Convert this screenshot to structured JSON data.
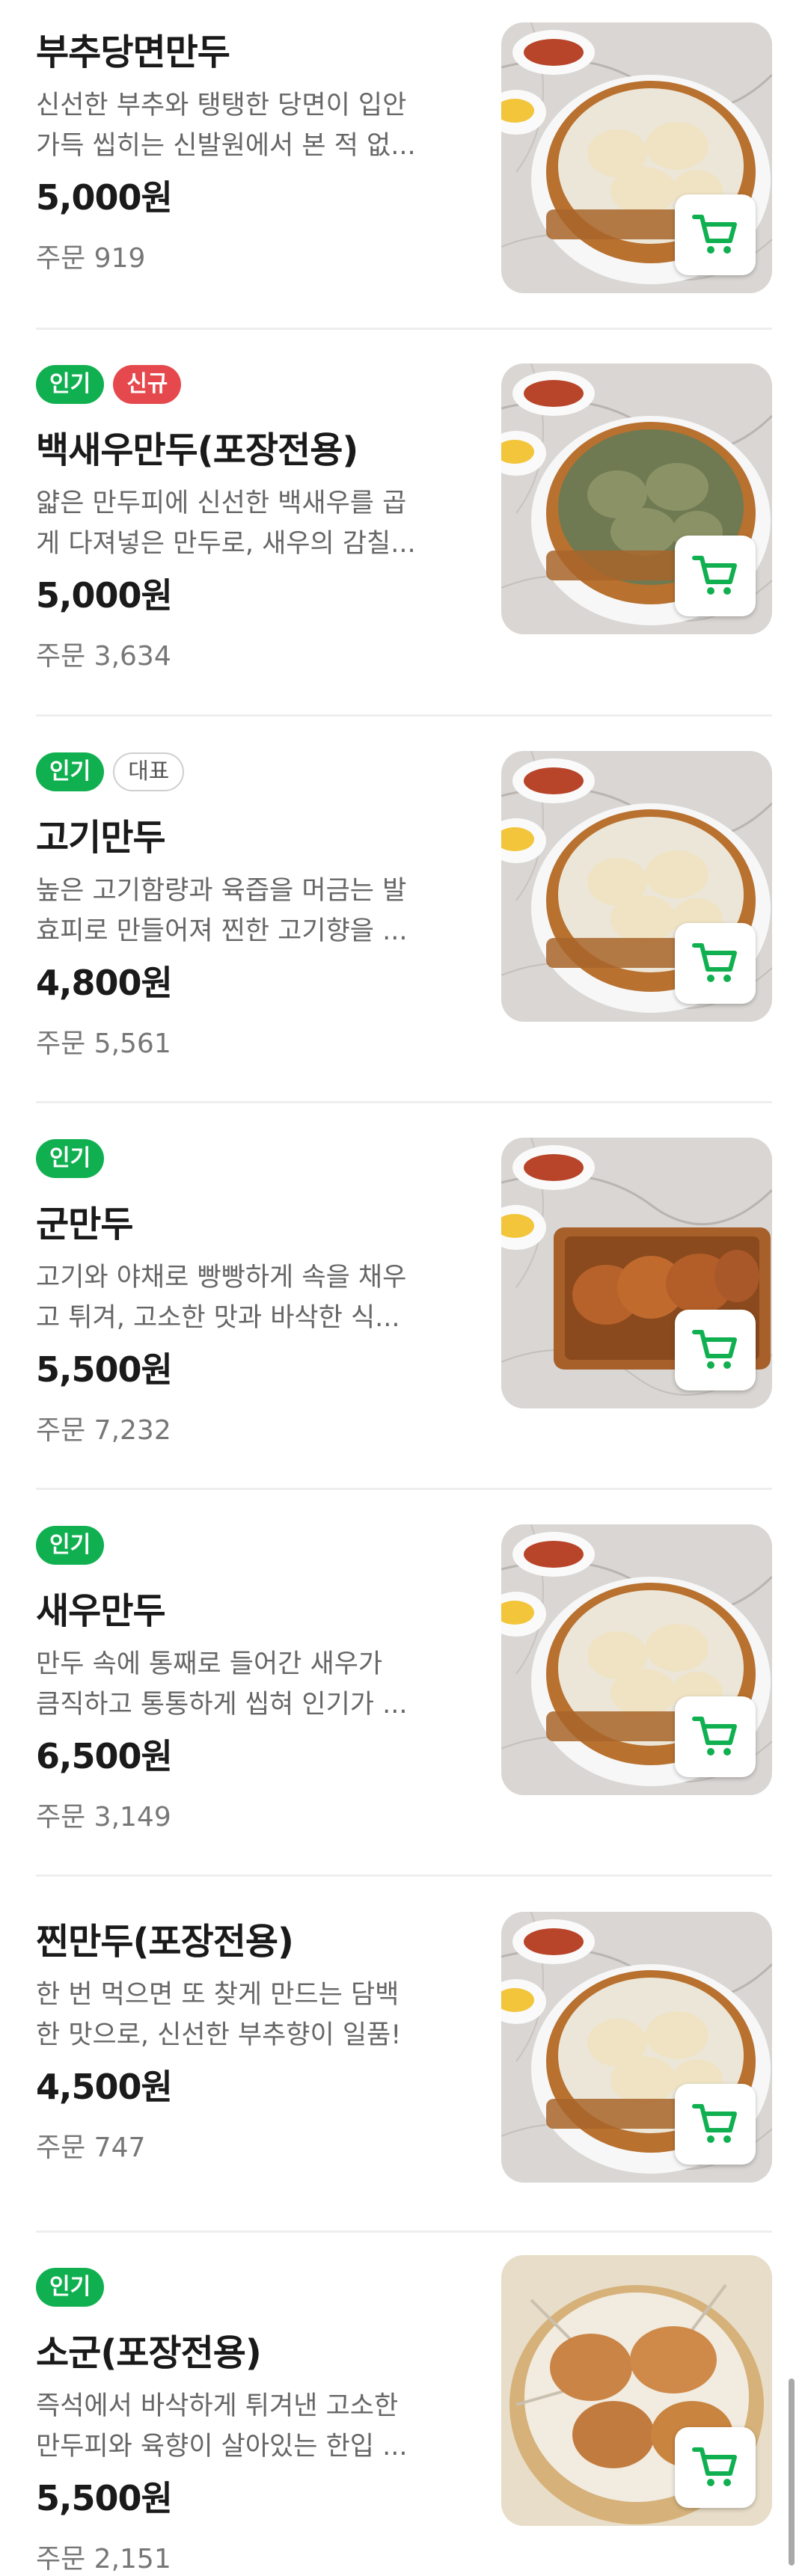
{
  "menu_items": [
    {
      "badges": [],
      "name": "부추당면만두",
      "desc_line1": "신선한 부추와 탱탱한 당면이 입안",
      "desc_line2": "가득 씹히는 신발원에서 본 적 없...",
      "price": "5,000원",
      "orders": "주문 919"
    },
    {
      "badges": [
        {
          "label": "인기",
          "kind": "popular"
        },
        {
          "label": "신규",
          "kind": "new"
        }
      ],
      "name": "백새우만두(포장전용)",
      "desc_line1": "얇은 만두피에 신선한 백새우를 곱",
      "desc_line2": "게 다져넣은 만두로, 새우의 감칠...",
      "price": "5,000원",
      "orders": "주문 3,634"
    },
    {
      "badges": [
        {
          "label": "인기",
          "kind": "popular"
        },
        {
          "label": "대표",
          "kind": "rep"
        }
      ],
      "name": "고기만두",
      "desc_line1": "높은 고기함량과 육즙을 머금는 발",
      "desc_line2": "효피로 만들어져 찐한 고기향을 ...",
      "price": "4,800원",
      "orders": "주문 5,561"
    },
    {
      "badges": [
        {
          "label": "인기",
          "kind": "popular"
        }
      ],
      "name": "군만두",
      "desc_line1": "고기와 야채로 빵빵하게 속을 채우",
      "desc_line2": "고 튀겨, 고소한 맛과 바삭한 식...",
      "price": "5,500원",
      "orders": "주문 7,232"
    },
    {
      "badges": [
        {
          "label": "인기",
          "kind": "popular"
        }
      ],
      "name": "새우만두",
      "desc_line1": "만두 속에 통째로 들어간 새우가",
      "desc_line2": "큼직하고 통통하게 씹혀 인기가 ...",
      "price": "6,500원",
      "orders": "주문 3,149"
    },
    {
      "badges": [],
      "name": "찐만두(포장전용)",
      "desc_line1": "한 번 먹으면 또 찾게 만드는 담백",
      "desc_line2": "한 맛으로, 신선한 부추향이 일품!",
      "price": "4,500원",
      "orders": "주문 747"
    },
    {
      "badges": [
        {
          "label": "인기",
          "kind": "popular"
        }
      ],
      "name": "소군(포장전용)",
      "desc_line1": "즉석에서 바삭하게 튀겨낸 고소한",
      "desc_line2": "만두피와 육향이 살아있는 한입 ...",
      "price": "5,500원",
      "orders": "주문 2,151"
    }
  ],
  "icons": {
    "cart": "cart-icon"
  },
  "colors": {
    "accent": "#10b050",
    "new_badge": "#e5484d"
  }
}
